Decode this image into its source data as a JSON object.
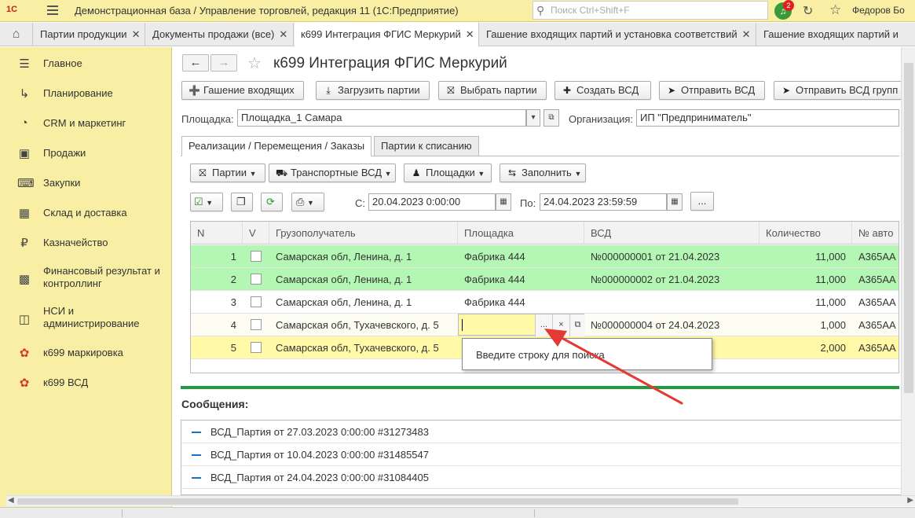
{
  "topbar": {
    "logo": "1С",
    "app_title": "Демонстрационная база / Управление торговлей, редакция 11  (1С:Предприятие)",
    "search_placeholder": "Поиск Ctrl+Shift+F",
    "notification_count": "2",
    "user": "Федоров Бо"
  },
  "tabs": [
    {
      "label": "Партии продукции"
    },
    {
      "label": "Документы продажи (все)"
    },
    {
      "label": "к699 Интеграция ФГИС Меркурий"
    },
    {
      "label": "Гашение входящих партий и установка соответствий"
    },
    {
      "label": "Гашение входящих партий и"
    }
  ],
  "sidebar": {
    "items": [
      {
        "label": "Главное",
        "icon": "list-icon"
      },
      {
        "label": "Планирование",
        "icon": "planning-icon"
      },
      {
        "label": "CRM и маркетинг",
        "icon": "pie-chart-icon"
      },
      {
        "label": "Продажи",
        "icon": "bag-icon"
      },
      {
        "label": "Закупки",
        "icon": "cart-icon"
      },
      {
        "label": "Склад и доставка",
        "icon": "warehouse-icon"
      },
      {
        "label": "Казначейство",
        "icon": "ruble-icon"
      },
      {
        "label": "Финансовый результат и контроллинг",
        "icon": "chart-icon"
      },
      {
        "label": "НСИ и администрирование",
        "icon": "settings-icon"
      },
      {
        "label": "к699 маркировка",
        "icon": "marking-icon"
      },
      {
        "label": "к699 ВСД",
        "icon": "vsd-icon"
      }
    ]
  },
  "page": {
    "title": "к699 Интеграция ФГИС Меркурий",
    "back_icon": "arrow-left-icon",
    "forward_icon": "arrow-right-icon"
  },
  "toolbar": {
    "buttons": [
      {
        "label": "Гашение входящих",
        "icon": "plus-icon"
      },
      {
        "label": "Загрузить партии",
        "icon": "download-icon"
      },
      {
        "label": "Выбрать партии",
        "icon": "basket-icon"
      },
      {
        "label": "Создать ВСД",
        "icon": "plus-icon"
      },
      {
        "label": "Отправить ВСД",
        "icon": "send-icon"
      },
      {
        "label": "Отправить ВСД групп",
        "icon": "send-icon"
      }
    ]
  },
  "filters": {
    "site_label": "Площадка:",
    "site_value": "Площадка_1 Самара",
    "org_label": "Организация:",
    "org_value": "ИП \"Предприниматель\""
  },
  "page_tabs": [
    {
      "label": "Реализации / Перемещения / Заказы",
      "active": true
    },
    {
      "label": "Партии к списанию",
      "active": false
    }
  ],
  "subtoolbar": {
    "buttons": [
      {
        "label": "Партии",
        "icon": "basket-icon"
      },
      {
        "label": "Транспортные ВСД",
        "icon": "truck-icon"
      },
      {
        "label": "Площадки",
        "icon": "person-icon"
      },
      {
        "label": "Заполнить",
        "icon": "swap-icon"
      }
    ]
  },
  "period": {
    "from_label": "С:",
    "from_value": "20.04.2023  0:00:00",
    "to_label": "По:",
    "to_value": "24.04.2023 23:59:59",
    "more_label": "..."
  },
  "table": {
    "columns": [
      "N",
      "V",
      "Грузополучатель",
      "Площадка",
      "ВСД",
      "Количество",
      "№ авто"
    ],
    "rows": [
      {
        "n": "1",
        "consignee": "Самарская обл, Ленина, д. 1",
        "site": "Фабрика 444",
        "vsd": "№000000001 от 21.04.2023",
        "qty": "11,000",
        "auto": "А365АА",
        "highlight": "green"
      },
      {
        "n": "2",
        "consignee": "Самарская обл, Ленина, д. 1",
        "site": "Фабрика 444",
        "vsd": "№000000002 от 21.04.2023",
        "qty": "11,000",
        "auto": "А365АА",
        "highlight": "green"
      },
      {
        "n": "3",
        "consignee": "Самарская обл, Ленина, д. 1",
        "site": "Фабрика 444",
        "vsd": "",
        "qty": "11,000",
        "auto": "А365АА",
        "highlight": "none"
      },
      {
        "n": "4",
        "consignee": "Самарская обл, Тухачевского, д. 5",
        "site": "",
        "vsd": "№000000004 от 24.04.2023",
        "qty": "1,000",
        "auto": "А365АА",
        "highlight": "editing"
      },
      {
        "n": "5",
        "consignee": "Самарская обл, Тухачевского, д. 5",
        "site": "",
        "vsd": "",
        "qty": "2,000",
        "auto": "А365АА",
        "highlight": "yellow"
      }
    ],
    "edit_select_label": "...",
    "edit_clear_label": "×",
    "popup_text": "Введите строку для поиска"
  },
  "messages": {
    "title": "Сообщения:",
    "items": [
      "ВСД_Партия от 27.03.2023 0:00:00 #31273483",
      "ВСД_Партия от 10.04.2023 0:00:00 #31485547",
      "ВСД_Партия от 24.04.2023 0:00:00 #31084405"
    ]
  },
  "colors": {
    "sidebar_bg": "#f8eea4",
    "row_green": "#b4f7b4",
    "row_yellow": "#fff9a8",
    "accent_green": "#1f9a3c",
    "annotation_arrow": "#e53935"
  }
}
